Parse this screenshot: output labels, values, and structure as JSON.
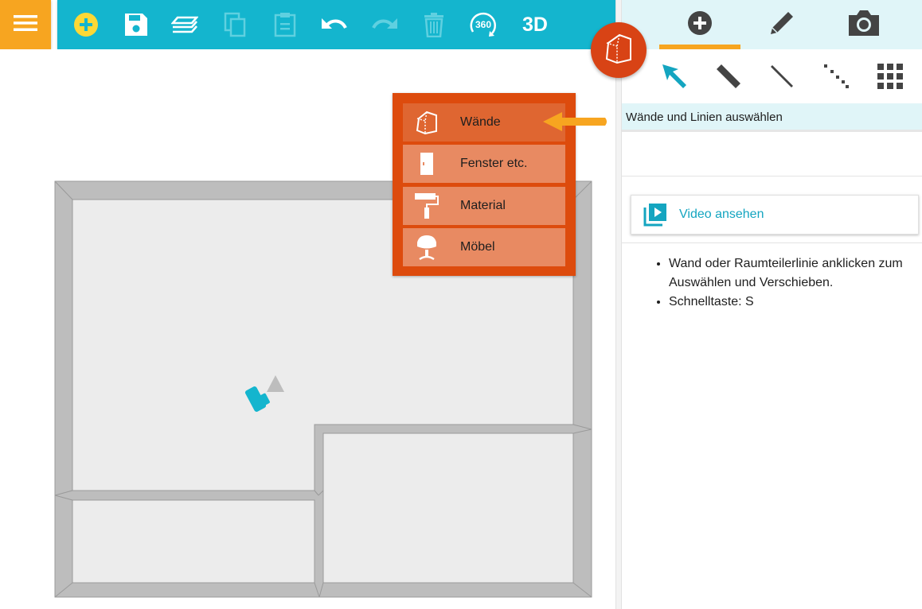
{
  "toolbar": {
    "menu_icon": "hamburger-icon",
    "buttons": [
      {
        "icon": "add-circle-icon",
        "enabled": true
      },
      {
        "icon": "save-icon",
        "enabled": true
      },
      {
        "icon": "layers-icon",
        "enabled": true
      },
      {
        "icon": "copy-icon",
        "enabled": false
      },
      {
        "icon": "paste-icon",
        "enabled": false
      },
      {
        "icon": "undo-icon",
        "enabled": true
      },
      {
        "icon": "redo-icon",
        "enabled": false
      },
      {
        "icon": "trash-icon",
        "enabled": false
      },
      {
        "icon": "view-360-icon",
        "label": "360",
        "enabled": true
      },
      {
        "icon": "view-3d-icon",
        "label": "3D",
        "enabled": true
      }
    ]
  },
  "popup_menu": {
    "items": [
      {
        "label": "Wände",
        "icon": "walls-icon",
        "active": true
      },
      {
        "label": "Fenster etc.",
        "icon": "door-icon",
        "active": false
      },
      {
        "label": "Material",
        "icon": "paint-roller-icon",
        "active": false
      },
      {
        "label": "Möbel",
        "icon": "chair-icon",
        "active": false
      }
    ]
  },
  "right_panel": {
    "tabs": [
      {
        "icon": "add-circle-icon",
        "active": true
      },
      {
        "icon": "pencil-icon",
        "active": false
      },
      {
        "icon": "camera-icon",
        "active": false
      }
    ],
    "tools": [
      {
        "icon": "select-arrow-icon",
        "active": true
      },
      {
        "icon": "thick-wall-icon",
        "active": false
      },
      {
        "icon": "thin-line-icon",
        "active": false
      },
      {
        "icon": "dotted-line-icon",
        "active": false
      },
      {
        "icon": "grid-icon",
        "active": false
      }
    ],
    "hint": "Wände und Linien auswählen",
    "video_button": "Video ansehen",
    "help_items": [
      "Wand oder Raumteilerlinie anklicken zum Auswählen und Verschieben.",
      "Schnelltaste: S"
    ]
  },
  "colors": {
    "toolbar": "#14b5ce",
    "menu_button": "#f7a520",
    "popup": "#dd4b0d",
    "accent": "#f7a520",
    "wall": "#bdbdbd",
    "floor": "#ececec"
  }
}
